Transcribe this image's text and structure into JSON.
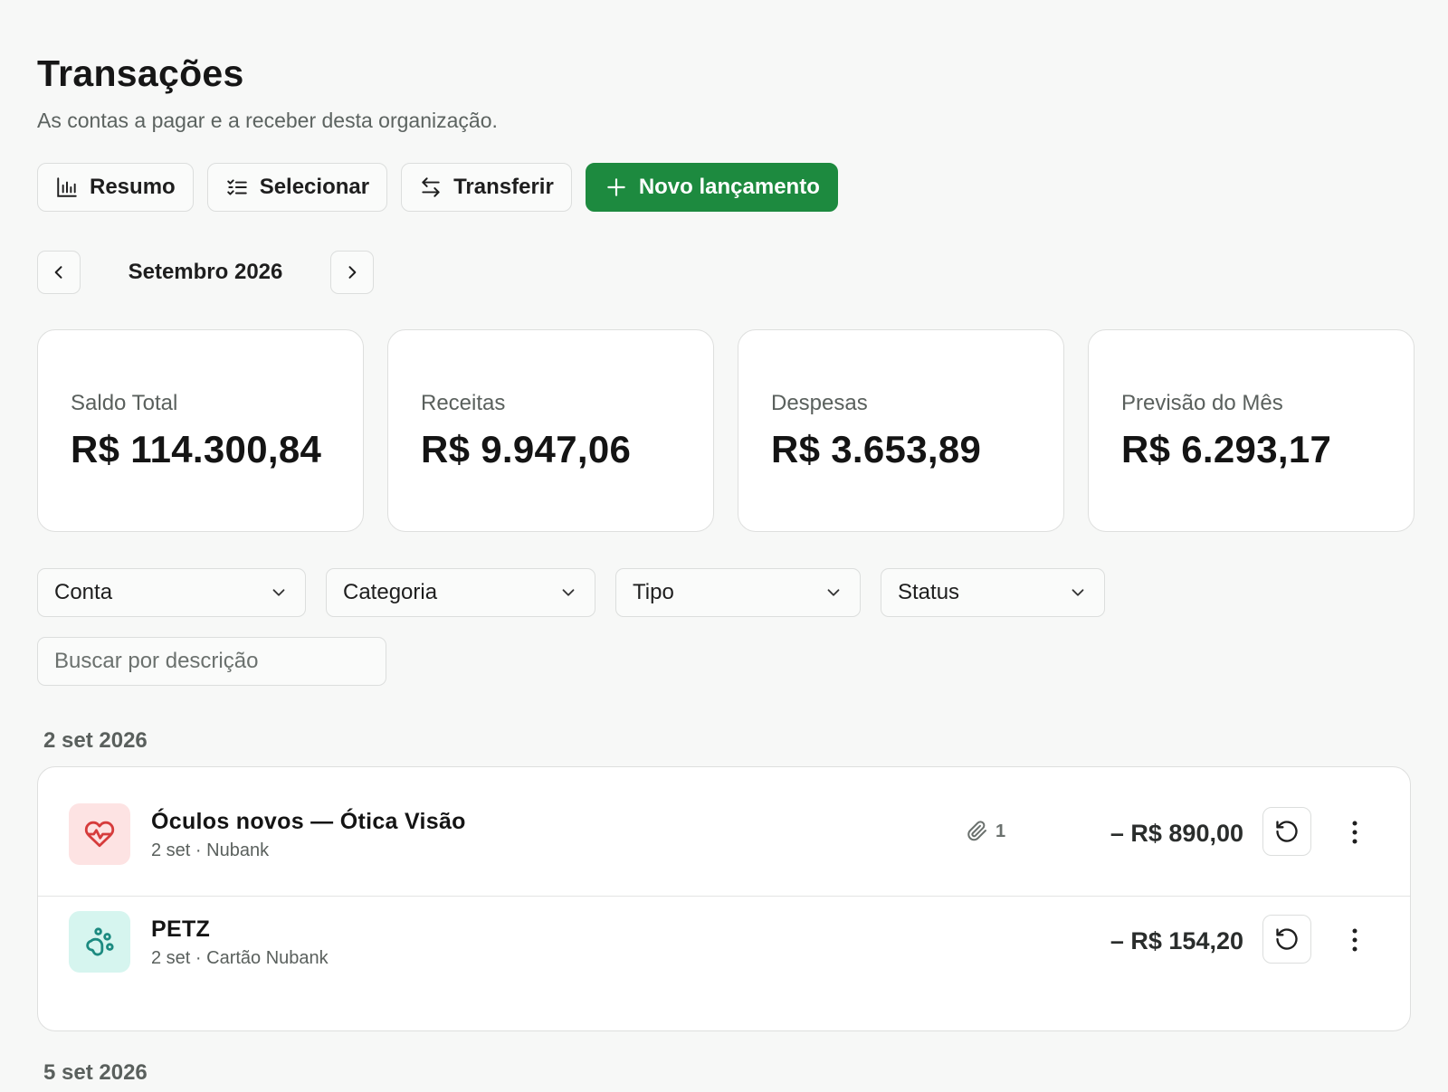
{
  "header": {
    "title": "Transações",
    "subtitle": "As contas a pagar e a receber desta organização."
  },
  "toolbar": {
    "summary_label": "Resumo",
    "select_label": "Selecionar",
    "transfer_label": "Transferir",
    "new_entry_label": "Novo lançamento"
  },
  "month_nav": {
    "label": "Setembro 2026"
  },
  "cards": [
    {
      "label": "Saldo Total",
      "value": "R$ 114.300,84"
    },
    {
      "label": "Receitas",
      "value": "R$ 9.947,06"
    },
    {
      "label": "Despesas",
      "value": "R$ 3.653,89"
    },
    {
      "label": "Previsão do Mês",
      "value": "R$ 6.293,17"
    }
  ],
  "filters": {
    "account": "Conta",
    "category": "Categoria",
    "type": "Tipo",
    "status": "Status",
    "search_placeholder": "Buscar por descrição"
  },
  "groups": [
    {
      "date": "2 set 2026",
      "transactions": [
        {
          "title": "Óculos novos — Ótica Visão",
          "subtitle": "2 set · Nubank",
          "attachments": "1",
          "amount": "– R$ 890,00",
          "icon": "heart-pulse-icon",
          "icon_color": "#d63c3c",
          "icon_bg": "#fde3e3"
        },
        {
          "title": "PETZ",
          "subtitle": "2 set · Cartão Nubank",
          "amount": "– R$ 154,20",
          "icon": "paw-icon",
          "icon_color": "#1c8a80",
          "icon_bg": "#d6f5ef"
        }
      ]
    },
    {
      "date": "5 set 2026"
    }
  ],
  "colors": {
    "primary": "#1d8a3f",
    "background": "#f7f8f7",
    "card_border": "#dedfde"
  }
}
